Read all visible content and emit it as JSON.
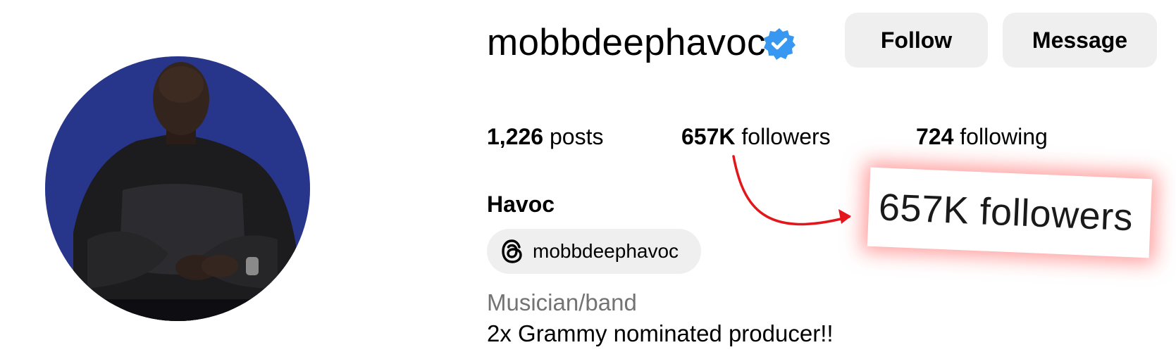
{
  "profile": {
    "username": "mobbdeephavoc",
    "full_name": "Havoc",
    "verified_icon": "verified-badge-icon",
    "verified_color": "#3897f0",
    "avatar_background": "#2a3a8f"
  },
  "actions": {
    "follow_label": "Follow",
    "message_label": "Message"
  },
  "stats": {
    "posts_count": "1,226",
    "posts_label": "posts",
    "followers_count": "657K",
    "followers_label": "followers",
    "following_count": "724",
    "following_label": "following"
  },
  "threads": {
    "icon": "threads-icon",
    "handle": "mobbdeephavoc"
  },
  "category": "Musician/band",
  "bio": "2x Grammy nominated producer!!",
  "annotation": {
    "callout_text": "657K followers",
    "arrow_color": "#e3161b",
    "glow_color": "#ff5050"
  }
}
